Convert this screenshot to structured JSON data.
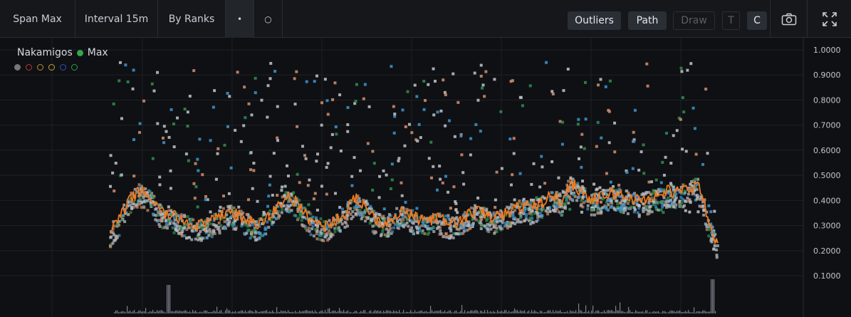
{
  "toolbar": {
    "span_label": "Span Max",
    "interval_label": "Interval 15m",
    "ranks_label": "By Ranks",
    "dot_filled": "•",
    "dot_hollow": "○",
    "outliers_label": "Outliers",
    "path_label": "Path",
    "draw_label": "Draw",
    "t_label": "T",
    "c_label": "C",
    "camera_icon": "camera-icon",
    "fullscreen_icon": "fullscreen-icon"
  },
  "legend": {
    "collection": "Nakamigos",
    "series": "Max",
    "series_color": "#2fa84f",
    "swatch_colors": [
      "#777777",
      "#b83a3a",
      "#b88a2a",
      "#c2a23a",
      "#2f4fb8",
      "#2f9a4f"
    ]
  },
  "colors": {
    "path": "#f07a1e",
    "blue": "#3a8fc7",
    "green": "#2e8a4e",
    "salmon": "#c98a6a",
    "grey": "#b7bcc3",
    "volume": "#7d838c"
  },
  "chart_data": {
    "type": "scatter",
    "y_ticks": [
      "1.0000",
      "0.9000",
      "0.8000",
      "0.7000",
      "0.6000",
      "0.5000",
      "0.4000",
      "0.3000",
      "0.2000",
      "0.1000"
    ],
    "ylim": [
      0.1,
      1.0
    ],
    "grid": true,
    "y_axis_side": "right",
    "baseline_path": [
      0.28,
      0.33,
      0.4,
      0.44,
      0.42,
      0.36,
      0.34,
      0.33,
      0.31,
      0.3,
      0.31,
      0.33,
      0.36,
      0.34,
      0.32,
      0.3,
      0.33,
      0.37,
      0.42,
      0.39,
      0.34,
      0.31,
      0.3,
      0.32,
      0.35,
      0.41,
      0.38,
      0.33,
      0.31,
      0.34,
      0.36,
      0.33,
      0.32,
      0.33,
      0.32,
      0.31,
      0.32,
      0.36,
      0.35,
      0.33,
      0.34,
      0.36,
      0.38,
      0.37,
      0.39,
      0.42,
      0.4,
      0.47,
      0.44,
      0.4,
      0.41,
      0.43,
      0.42,
      0.41,
      0.4,
      0.41,
      0.42,
      0.44,
      0.43,
      0.45,
      0.46,
      0.33,
      0.22
    ]
  }
}
